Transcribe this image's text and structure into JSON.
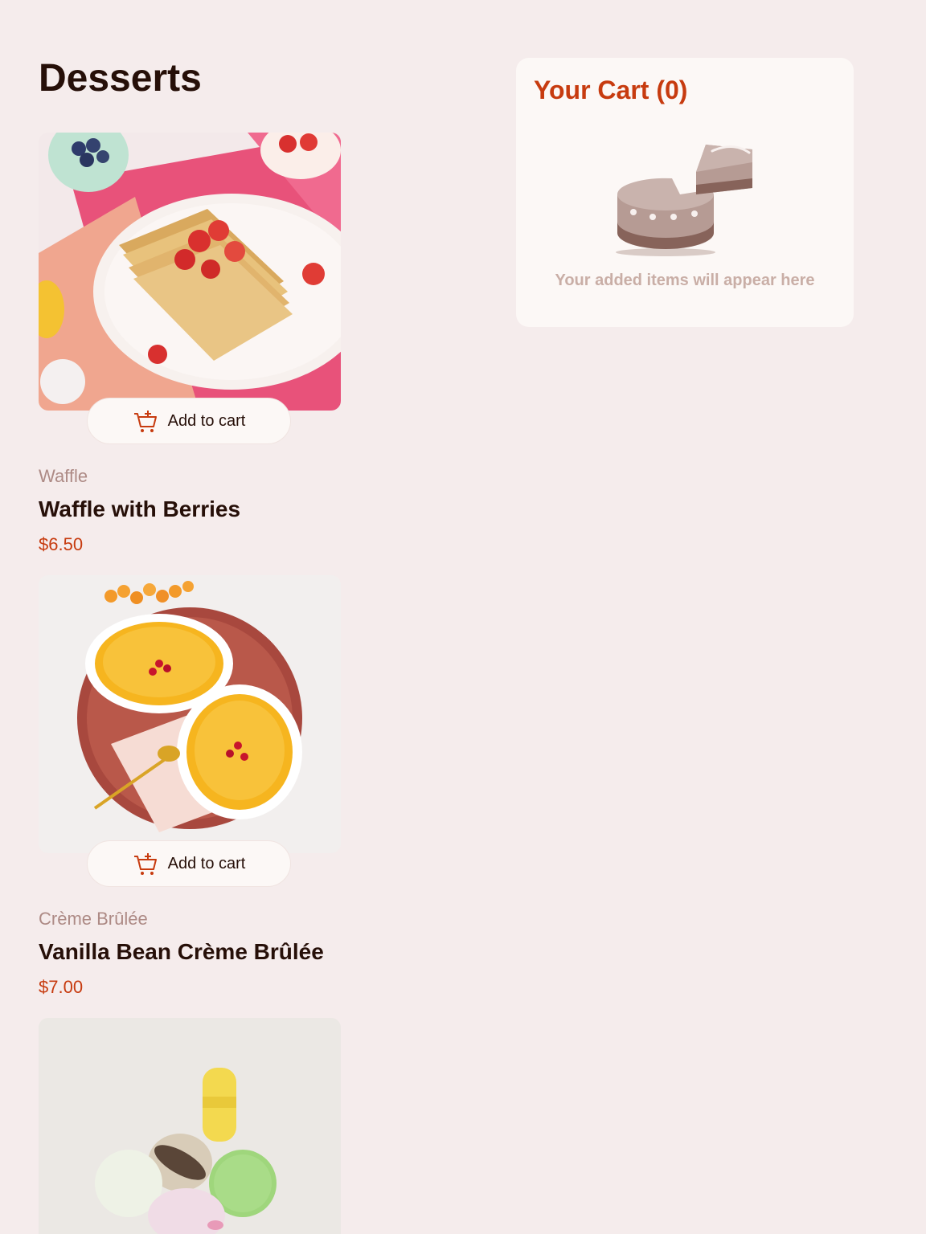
{
  "page": {
    "title": "Desserts"
  },
  "products": [
    {
      "image": "waffle-photo",
      "button_label": "Add to cart",
      "category": "Waffle",
      "name": "Waffle with Berries",
      "price": "$6.50"
    },
    {
      "image": "creme-brulee-photo",
      "button_label": "Add to cart",
      "category": "Crème Brûlée",
      "name": "Vanilla Bean Crème Brûlée",
      "price": "$7.00"
    },
    {
      "image": "macaron-photo"
    }
  ],
  "cart": {
    "title": "Your Cart (0)",
    "empty_icon": "cake-icon",
    "empty_message": "Your added items will appear here"
  },
  "colors": {
    "background": "#f5ecec",
    "accent": "#c73b0f",
    "text": "#260f08",
    "muted": "#ad8a85",
    "cart_bg": "#fcf8f6"
  }
}
